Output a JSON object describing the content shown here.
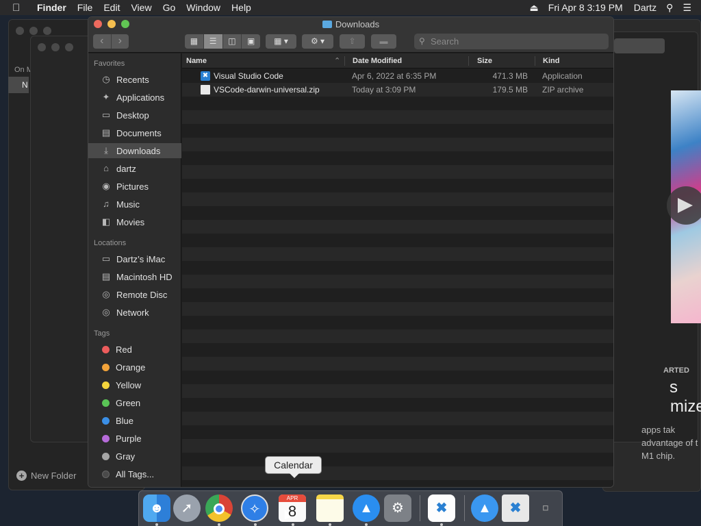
{
  "menubar": {
    "apple_icon": "apple-logo-icon",
    "app_name": "Finder",
    "items": [
      "File",
      "Edit",
      "View",
      "Go",
      "Window",
      "Help"
    ],
    "eject_icon": "eject-icon",
    "datetime": "Fri Apr 8  3:19 PM",
    "user": "Dartz",
    "search_icon": "spotlight-search-icon",
    "menu_icon": "control-center-icon"
  },
  "background": {
    "sidebar_heading": "On M",
    "selected_item": "N",
    "new_folder_label": "New Folder",
    "promo_heading": "ARTED",
    "promo_big_1": "s",
    "promo_big_2": "mize",
    "promo_text": "apps tak advantage of t M1 chip."
  },
  "finder": {
    "title": "Downloads",
    "search_placeholder": "Search",
    "toolbar": {
      "back": "‹",
      "forward": "›",
      "view_icons": "icon-view-icon",
      "view_list": "list-view-icon",
      "view_columns": "column-view-icon",
      "view_gallery": "gallery-view-icon",
      "group_icon": "group-by-icon",
      "action_icon": "gear-icon",
      "share_icon": "share-icon",
      "tag_icon": "tag-icon"
    },
    "sidebar": {
      "favorites_heading": "Favorites",
      "favorites": [
        {
          "label": "Recents",
          "icon": "clock-icon"
        },
        {
          "label": "Applications",
          "icon": "applications-icon"
        },
        {
          "label": "Desktop",
          "icon": "desktop-icon"
        },
        {
          "label": "Documents",
          "icon": "document-icon"
        },
        {
          "label": "Downloads",
          "icon": "download-icon",
          "selected": true
        },
        {
          "label": "dartz",
          "icon": "home-icon"
        },
        {
          "label": "Pictures",
          "icon": "camera-icon"
        },
        {
          "label": "Music",
          "icon": "music-icon"
        },
        {
          "label": "Movies",
          "icon": "film-icon"
        }
      ],
      "locations_heading": "Locations",
      "locations": [
        {
          "label": "Dartz’s iMac",
          "icon": "imac-icon"
        },
        {
          "label": "Macintosh HD",
          "icon": "hard-drive-icon"
        },
        {
          "label": "Remote Disc",
          "icon": "disc-icon"
        },
        {
          "label": "Network",
          "icon": "globe-icon"
        }
      ],
      "tags_heading": "Tags",
      "tags": [
        {
          "label": "Red",
          "color": "#ec5c5c"
        },
        {
          "label": "Orange",
          "color": "#f2a33a"
        },
        {
          "label": "Yellow",
          "color": "#f4d43c"
        },
        {
          "label": "Green",
          "color": "#5ac456"
        },
        {
          "label": "Blue",
          "color": "#3b8fe6"
        },
        {
          "label": "Purple",
          "color": "#b66bd9"
        },
        {
          "label": "Gray",
          "color": "#a5a5a5"
        },
        {
          "label": "All Tags...",
          "color": "#4a4a4a"
        }
      ]
    },
    "columns": {
      "name": "Name",
      "date": "Date Modified",
      "size": "Size",
      "kind": "Kind"
    },
    "files": [
      {
        "name": "Visual Studio Code",
        "date": "Apr 6, 2022 at 6:35 PM",
        "size": "471.3 MB",
        "kind": "Application",
        "icon": "vscode-app-icon"
      },
      {
        "name": "VSCode-darwin-universal.zip",
        "date": "Today at 3:09 PM",
        "size": "179.5 MB",
        "kind": "ZIP archive",
        "icon": "zip-file-icon"
      }
    ]
  },
  "dock": {
    "tooltip": "Calendar",
    "calendar_month": "APR",
    "calendar_day": "8",
    "apps": [
      "finder-icon",
      "launchpad-icon",
      "chrome-icon",
      "safari-icon",
      "calendar-icon",
      "notes-icon",
      "app-store-icon",
      "system-preferences-icon",
      "vscode-icon",
      "app-store-downloads-icon",
      "vscode-downloads-icon",
      "trash-icon"
    ]
  }
}
